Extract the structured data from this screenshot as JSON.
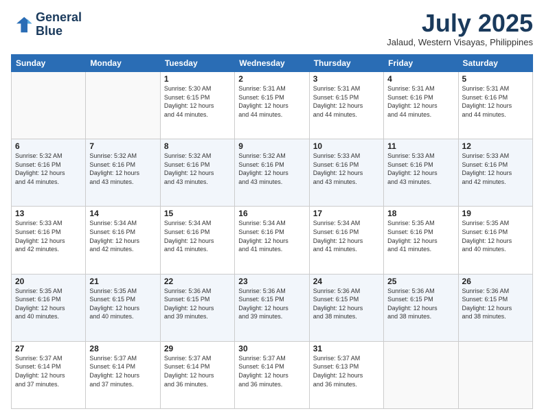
{
  "logo": {
    "line1": "General",
    "line2": "Blue"
  },
  "title": "July 2025",
  "location": "Jalaud, Western Visayas, Philippines",
  "days_of_week": [
    "Sunday",
    "Monday",
    "Tuesday",
    "Wednesday",
    "Thursday",
    "Friday",
    "Saturday"
  ],
  "weeks": [
    [
      {
        "num": "",
        "info": ""
      },
      {
        "num": "",
        "info": ""
      },
      {
        "num": "1",
        "info": "Sunrise: 5:30 AM\nSunset: 6:15 PM\nDaylight: 12 hours\nand 44 minutes."
      },
      {
        "num": "2",
        "info": "Sunrise: 5:31 AM\nSunset: 6:15 PM\nDaylight: 12 hours\nand 44 minutes."
      },
      {
        "num": "3",
        "info": "Sunrise: 5:31 AM\nSunset: 6:15 PM\nDaylight: 12 hours\nand 44 minutes."
      },
      {
        "num": "4",
        "info": "Sunrise: 5:31 AM\nSunset: 6:16 PM\nDaylight: 12 hours\nand 44 minutes."
      },
      {
        "num": "5",
        "info": "Sunrise: 5:31 AM\nSunset: 6:16 PM\nDaylight: 12 hours\nand 44 minutes."
      }
    ],
    [
      {
        "num": "6",
        "info": "Sunrise: 5:32 AM\nSunset: 6:16 PM\nDaylight: 12 hours\nand 44 minutes."
      },
      {
        "num": "7",
        "info": "Sunrise: 5:32 AM\nSunset: 6:16 PM\nDaylight: 12 hours\nand 43 minutes."
      },
      {
        "num": "8",
        "info": "Sunrise: 5:32 AM\nSunset: 6:16 PM\nDaylight: 12 hours\nand 43 minutes."
      },
      {
        "num": "9",
        "info": "Sunrise: 5:32 AM\nSunset: 6:16 PM\nDaylight: 12 hours\nand 43 minutes."
      },
      {
        "num": "10",
        "info": "Sunrise: 5:33 AM\nSunset: 6:16 PM\nDaylight: 12 hours\nand 43 minutes."
      },
      {
        "num": "11",
        "info": "Sunrise: 5:33 AM\nSunset: 6:16 PM\nDaylight: 12 hours\nand 43 minutes."
      },
      {
        "num": "12",
        "info": "Sunrise: 5:33 AM\nSunset: 6:16 PM\nDaylight: 12 hours\nand 42 minutes."
      }
    ],
    [
      {
        "num": "13",
        "info": "Sunrise: 5:33 AM\nSunset: 6:16 PM\nDaylight: 12 hours\nand 42 minutes."
      },
      {
        "num": "14",
        "info": "Sunrise: 5:34 AM\nSunset: 6:16 PM\nDaylight: 12 hours\nand 42 minutes."
      },
      {
        "num": "15",
        "info": "Sunrise: 5:34 AM\nSunset: 6:16 PM\nDaylight: 12 hours\nand 41 minutes."
      },
      {
        "num": "16",
        "info": "Sunrise: 5:34 AM\nSunset: 6:16 PM\nDaylight: 12 hours\nand 41 minutes."
      },
      {
        "num": "17",
        "info": "Sunrise: 5:34 AM\nSunset: 6:16 PM\nDaylight: 12 hours\nand 41 minutes."
      },
      {
        "num": "18",
        "info": "Sunrise: 5:35 AM\nSunset: 6:16 PM\nDaylight: 12 hours\nand 41 minutes."
      },
      {
        "num": "19",
        "info": "Sunrise: 5:35 AM\nSunset: 6:16 PM\nDaylight: 12 hours\nand 40 minutes."
      }
    ],
    [
      {
        "num": "20",
        "info": "Sunrise: 5:35 AM\nSunset: 6:16 PM\nDaylight: 12 hours\nand 40 minutes."
      },
      {
        "num": "21",
        "info": "Sunrise: 5:35 AM\nSunset: 6:15 PM\nDaylight: 12 hours\nand 40 minutes."
      },
      {
        "num": "22",
        "info": "Sunrise: 5:36 AM\nSunset: 6:15 PM\nDaylight: 12 hours\nand 39 minutes."
      },
      {
        "num": "23",
        "info": "Sunrise: 5:36 AM\nSunset: 6:15 PM\nDaylight: 12 hours\nand 39 minutes."
      },
      {
        "num": "24",
        "info": "Sunrise: 5:36 AM\nSunset: 6:15 PM\nDaylight: 12 hours\nand 38 minutes."
      },
      {
        "num": "25",
        "info": "Sunrise: 5:36 AM\nSunset: 6:15 PM\nDaylight: 12 hours\nand 38 minutes."
      },
      {
        "num": "26",
        "info": "Sunrise: 5:36 AM\nSunset: 6:15 PM\nDaylight: 12 hours\nand 38 minutes."
      }
    ],
    [
      {
        "num": "27",
        "info": "Sunrise: 5:37 AM\nSunset: 6:14 PM\nDaylight: 12 hours\nand 37 minutes."
      },
      {
        "num": "28",
        "info": "Sunrise: 5:37 AM\nSunset: 6:14 PM\nDaylight: 12 hours\nand 37 minutes."
      },
      {
        "num": "29",
        "info": "Sunrise: 5:37 AM\nSunset: 6:14 PM\nDaylight: 12 hours\nand 36 minutes."
      },
      {
        "num": "30",
        "info": "Sunrise: 5:37 AM\nSunset: 6:14 PM\nDaylight: 12 hours\nand 36 minutes."
      },
      {
        "num": "31",
        "info": "Sunrise: 5:37 AM\nSunset: 6:13 PM\nDaylight: 12 hours\nand 36 minutes."
      },
      {
        "num": "",
        "info": ""
      },
      {
        "num": "",
        "info": ""
      }
    ]
  ]
}
